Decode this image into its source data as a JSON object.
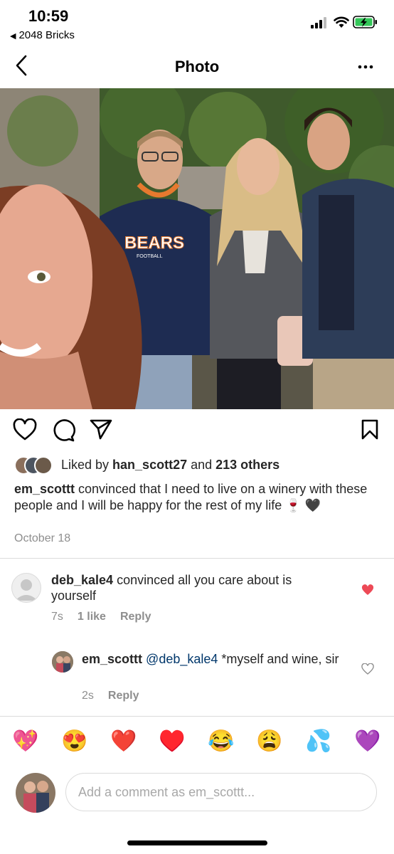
{
  "status_bar": {
    "time": "10:59",
    "back_app": "2048 Bricks"
  },
  "nav": {
    "title": "Photo"
  },
  "post": {
    "likes_prefix": "Liked by ",
    "liked_user": "han_scott27",
    "likes_mid": " and ",
    "likes_others": "213 others",
    "caption_user": "em_scottt",
    "caption_text": " convinced that I need to live on a winery with these people and I will be happy for the rest of my life 🍷 🖤",
    "date": "October 18"
  },
  "comments": [
    {
      "user": "deb_kale4",
      "text": " convinced all you care about is yourself",
      "time": "7s",
      "likes": "1 like",
      "reply": "Reply",
      "liked": true
    },
    {
      "user": "em_scottt",
      "mention": "@deb_kale4",
      "text": " *myself and wine, sir",
      "time": "2s",
      "reply": "Reply",
      "liked": false
    }
  ],
  "emoji_bar": [
    "💖",
    "😍",
    "❤️",
    "♥️",
    "😂",
    "😩",
    "💦",
    "💜"
  ],
  "comment_input": {
    "placeholder": "Add a comment as em_scottt..."
  },
  "colors": {
    "like_red": "#ed4956",
    "text": "#262626",
    "muted": "#8e8e8e",
    "mention": "#00376b"
  }
}
